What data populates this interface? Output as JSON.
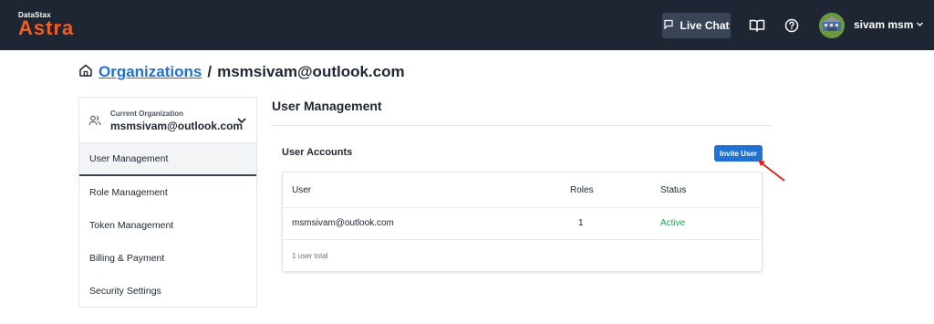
{
  "header": {
    "logo_small": "DataStax",
    "logo_big": "Astra",
    "live_chat": "Live Chat",
    "user_name": "sivam msm",
    "icons": [
      "chat-icon",
      "book-icon",
      "help-icon",
      "chevron-down-icon"
    ]
  },
  "breadcrumb": {
    "root": "Organizations",
    "separator": "/",
    "current": "msmsivam@outlook.com"
  },
  "sidebar": {
    "org_caption": "Current Organization",
    "org_value": "msmsivam@outlook.com",
    "items": [
      {
        "label": "User Management",
        "active": true
      },
      {
        "label": "Role Management"
      },
      {
        "label": "Token Management"
      },
      {
        "label": "Billing & Payment"
      },
      {
        "label": "Security Settings"
      }
    ]
  },
  "main": {
    "title": "User Management",
    "section_title": "User Accounts",
    "invite_button": "Invite User",
    "table": {
      "headers": [
        "User",
        "Roles",
        "Status"
      ],
      "rows": [
        {
          "user": "msmsivam@outlook.com",
          "roles": "1",
          "status": "Active"
        }
      ],
      "total": "1 user total"
    }
  },
  "colors": {
    "header_bg": "#1e2533",
    "brand_orange": "#f45d22",
    "link_blue": "#1f72d4",
    "status_green": "#1fa855",
    "annotation_red": "#e02020"
  }
}
